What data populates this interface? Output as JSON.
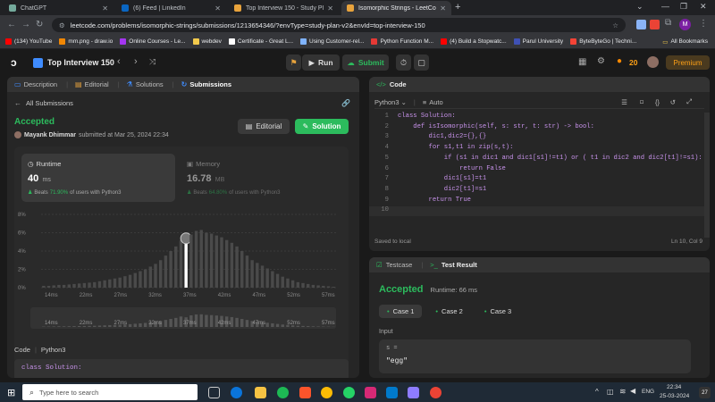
{
  "browser": {
    "tabs": [
      {
        "label": "ChatGPT",
        "color": "#74aa9c",
        "active": false
      },
      {
        "label": "(6) Feed | LinkedIn",
        "color": "#0a66c2",
        "active": false
      },
      {
        "label": "Top Interview 150 - Study Plan -",
        "color": "#e8a33c",
        "active": false
      },
      {
        "label": "Isomorphic Strings - LeetCode",
        "color": "#e8a33c",
        "active": true
      }
    ],
    "new_tab": "+",
    "url": "leetcode.com/problems/isomorphic-strings/submissions/1213654346/?envType=study-plan-v2&envId=top-interview-150",
    "profile_initial": "M",
    "bookmarks": [
      {
        "label": "(134) YouTube",
        "color": "#ff0000"
      },
      {
        "label": "mm.png - draw.io",
        "color": "#f08705"
      },
      {
        "label": "Online Courses - Le...",
        "color": "#a435f0"
      },
      {
        "label": "webdev",
        "color": "#f2c94c"
      },
      {
        "label": "Certificate - Great L...",
        "color": "#ffffff"
      },
      {
        "label": "Using Customer-rel...",
        "color": "#7fb3ff"
      },
      {
        "label": "Python Function M...",
        "color": "#e53935"
      },
      {
        "label": "(4) Build a Stopwatc...",
        "color": "#ff0000"
      },
      {
        "label": "Parul University",
        "color": "#3f51b5"
      },
      {
        "label": "ByteByteGo | Techni...",
        "color": "#f44336"
      }
    ],
    "all_bookmarks": "All Bookmarks"
  },
  "header": {
    "title": "Top Interview 150",
    "run_label": "Run",
    "submit_label": "Submit",
    "streak": "20",
    "premium_label": "Premium"
  },
  "left_panel": {
    "tabs": [
      {
        "label": "Description",
        "icon": "description-icon",
        "active": false
      },
      {
        "label": "Editorial",
        "icon": "editorial-icon",
        "active": false
      },
      {
        "label": "Solutions",
        "icon": "solutions-icon",
        "active": false
      },
      {
        "label": "Submissions",
        "icon": "submissions-icon",
        "active": true
      }
    ],
    "back_label": "All Submissions",
    "status": "Accepted",
    "user": "Mayank Dhimmar",
    "submitted_text": "submitted at Mar 25, 2024 22:34",
    "editorial_btn": "Editorial",
    "solution_btn": "Solution",
    "runtime": {
      "label": "Runtime",
      "value": "40",
      "unit": "ms",
      "beats_prefix": "Beats",
      "beats_pct": "71.90%",
      "beats_suffix": "of users with Python3"
    },
    "memory": {
      "label": "Memory",
      "value": "16.78",
      "unit": "MB",
      "beats_prefix": "Beats",
      "beats_pct": "64.80%",
      "beats_suffix": "of users with Python3"
    },
    "code_label": "Code",
    "code_lang": "Python3",
    "code_preview": "class Solution:"
  },
  "chart_data": {
    "type": "bar",
    "ylim": [
      0,
      8
    ],
    "yticks": [
      "8%",
      "6%",
      "4%",
      "2%",
      "0%"
    ],
    "xticks": [
      "14ms",
      "22ms",
      "27ms",
      "32ms",
      "37ms",
      "42ms",
      "47ms",
      "52ms",
      "57ms"
    ],
    "mini_xticks": [
      "14ms",
      "22ms",
      "27ms",
      "32ms",
      "37ms",
      "42ms",
      "47ms",
      "52ms",
      "57ms"
    ],
    "highlight_index": 28,
    "values": [
      0.2,
      0.2,
      0.25,
      0.3,
      0.3,
      0.35,
      0.4,
      0.45,
      0.5,
      0.55,
      0.6,
      0.7,
      0.8,
      0.9,
      1.0,
      1.1,
      1.25,
      1.4,
      1.6,
      1.8,
      2.0,
      2.3,
      2.6,
      3.0,
      3.5,
      4.0,
      4.5,
      5.2,
      4.8,
      5.8,
      6.2,
      6.3,
      6.0,
      5.9,
      5.7,
      5.5,
      5.2,
      4.9,
      4.5,
      4.0,
      3.5,
      3.0,
      2.7,
      2.4,
      2.1,
      1.8,
      1.5,
      1.2,
      1.0,
      0.8,
      0.6,
      0.5,
      0.4,
      0.3,
      0.25,
      0.2,
      0.15,
      0.1
    ]
  },
  "code_panel": {
    "title": "Code",
    "lang": "Python3",
    "auto": "Auto",
    "lines": [
      "class Solution:",
      "    def isIsomorphic(self, s: str, t: str) -> bool:",
      "        dic1,dic2={},{}",
      "        for s1,t1 in zip(s,t):",
      "            if (s1 in dic1 and dic1[s1]!=t1) or ( t1 in dic2 and dic2[t1]!=s1):",
      "                return False",
      "            dic1[s1]=t1",
      "            dic2[t1]=s1",
      "        return True",
      ""
    ],
    "line_numbers": [
      "1",
      "2",
      "3",
      "4",
      "5",
      "6",
      "7",
      "8",
      "9",
      "10"
    ],
    "saved": "Saved to local",
    "cursor": "Ln 10, Col 9"
  },
  "test_panel": {
    "testcase_tab": "Testcase",
    "result_tab": "Test Result",
    "status": "Accepted",
    "runtime": "Runtime: 66 ms",
    "cases": [
      "Case 1",
      "Case 2",
      "Case 3"
    ],
    "input_label": "Input",
    "var_name": "s =",
    "var_value": "\"egg\""
  },
  "taskbar": {
    "search_placeholder": "Type here to search",
    "lang": "ENG",
    "time": "22:34",
    "date": "25-03-2024",
    "badge": "27"
  }
}
